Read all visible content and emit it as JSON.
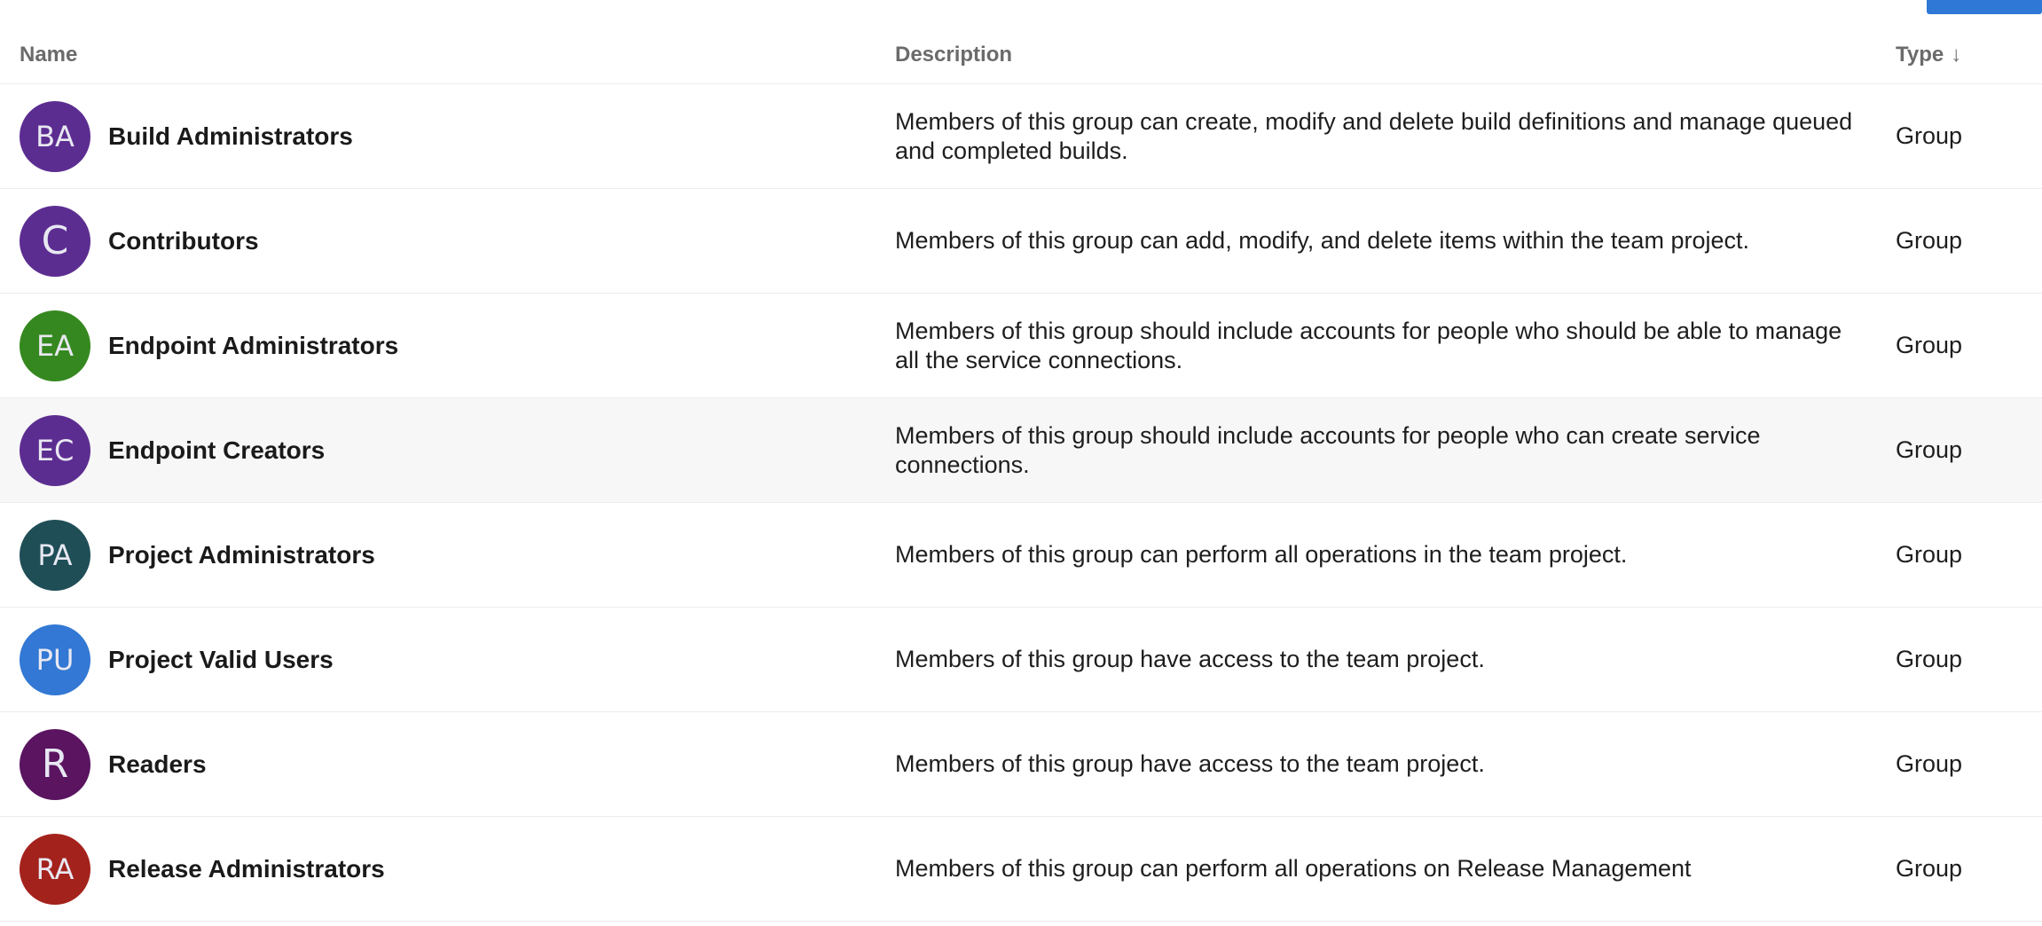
{
  "toolbar": {
    "action_button_label": ""
  },
  "columns": {
    "name": "Name",
    "description": "Description",
    "type": "Type",
    "type_sort_icon": "↓"
  },
  "rows": [
    {
      "initials": "BA",
      "color": "#5c2d91",
      "name": "Build Administrators",
      "description": "Members of this group can create, modify and delete build definitions and manage queued and completed builds.",
      "type": "Group"
    },
    {
      "initials": "C",
      "color": "#5c2d91",
      "name": "Contributors",
      "description": "Members of this group can add, modify, and delete items within the team project.",
      "type": "Group"
    },
    {
      "initials": "EA",
      "color": "#35881f",
      "name": "Endpoint Administrators",
      "description": "Members of this group should include accounts for people who should be able to manage all the service connections.",
      "type": "Group"
    },
    {
      "initials": "EC",
      "color": "#5c2d91",
      "name": "Endpoint Creators",
      "description": "Members of this group should include accounts for people who can create service connections.",
      "type": "Group"
    },
    {
      "initials": "PA",
      "color": "#1f4e57",
      "name": "Project Administrators",
      "description": "Members of this group can perform all operations in the team project.",
      "type": "Group"
    },
    {
      "initials": "PU",
      "color": "#3278d4",
      "name": "Project Valid Users",
      "description": "Members of this group have access to the team project.",
      "type": "Group"
    },
    {
      "initials": "R",
      "color": "#5a1460",
      "name": "Readers",
      "description": "Members of this group have access to the team project.",
      "type": "Group"
    },
    {
      "initials": "RA",
      "color": "#a4221c",
      "name": "Release Administrators",
      "description": "Members of this group can perform all operations on Release Management",
      "type": "Group"
    }
  ],
  "highlighted_row": "Endpoint Creators"
}
